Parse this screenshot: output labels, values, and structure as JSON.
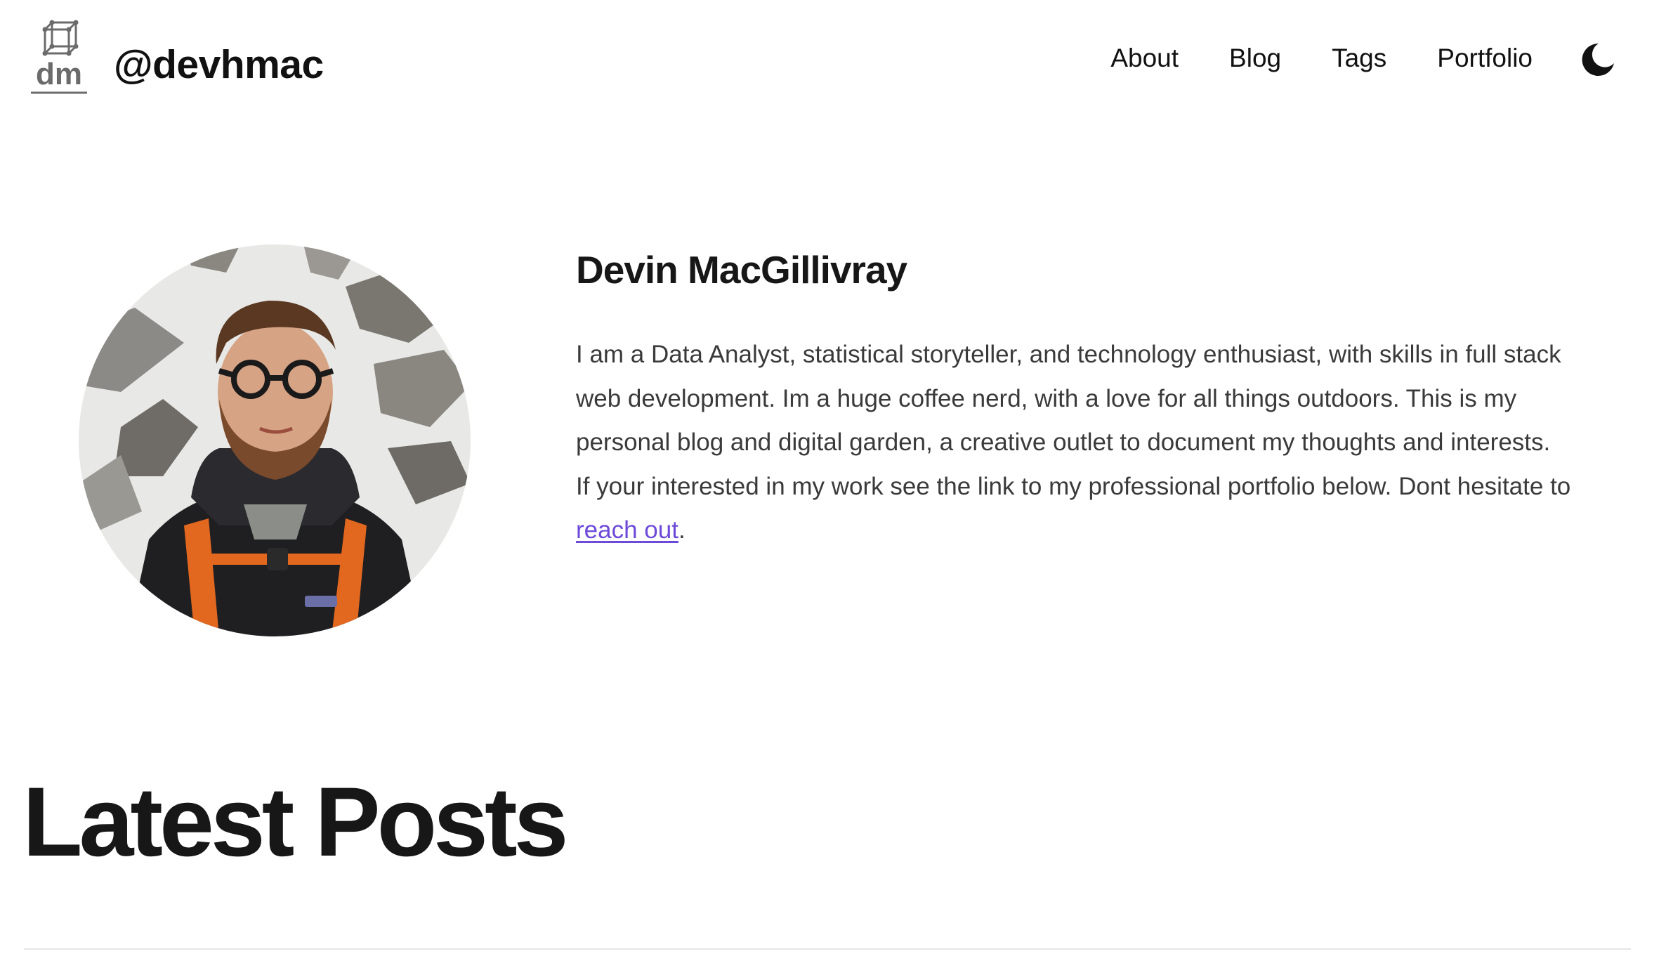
{
  "header": {
    "logo_icon": "dm-cube-logo-icon",
    "logo_text": "dm",
    "site_handle": "@devhmac",
    "nav": [
      {
        "label": "About"
      },
      {
        "label": "Blog"
      },
      {
        "label": "Tags"
      },
      {
        "label": "Portfolio"
      }
    ],
    "theme_toggle_icon": "moon-icon"
  },
  "about": {
    "avatar_icon": "profile-photo",
    "name": "Devin MacGillivray",
    "bio_para1": "I am a Data Analyst, statistical storyteller, and technology enthusiast, with skills in full stack web development. Im a huge coffee nerd, with a love for all things outdoors. This is my personal blog and digital garden, a creative outlet to document my thoughts and interests.",
    "bio_para2_prefix": "If your interested in my work see the link to my professional portfolio below. Dont hesitate to ",
    "bio_link": "reach out",
    "bio_para2_suffix": "."
  },
  "latest": {
    "title": "Latest Posts"
  },
  "colors": {
    "text": "#171717",
    "body_text": "#3a3a3a",
    "link": "#6d4bd8",
    "divider": "#e5e5e5",
    "background": "#ffffff"
  }
}
